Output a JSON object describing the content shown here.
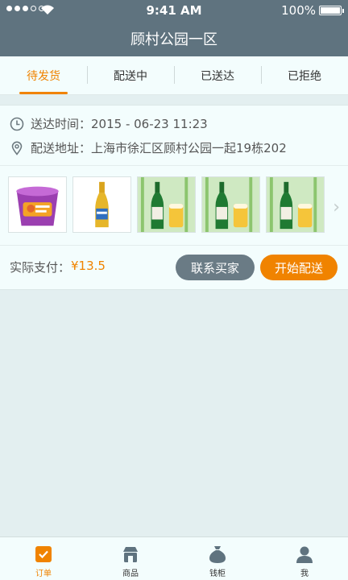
{
  "status": {
    "time": "9:41 AM",
    "battery": "100%"
  },
  "nav": {
    "title": "顾村公园一区"
  },
  "tabs": [
    {
      "label": "待发货",
      "active": true
    },
    {
      "label": "配送中",
      "active": false
    },
    {
      "label": "已送达",
      "active": false
    },
    {
      "label": "已拒绝",
      "active": false
    }
  ],
  "order": {
    "time_label": "送达时间：",
    "time_value": "2015 - 06-23   11:23",
    "address_label": "配送地址：",
    "address_value": "上海市徐汇区顾村公园一起19栋202",
    "products": [
      "instant-noodle-cup",
      "beer-bottle",
      "beer-green-bottles",
      "beer-green-bottles",
      "beer-green-bottles"
    ],
    "pay_label": "实际支付：",
    "pay_amount": "¥13.5",
    "contact_button": "联系买家",
    "start_button": "开始配送"
  },
  "tabbar": [
    {
      "label": "订单",
      "icon": "order-icon",
      "active": true
    },
    {
      "label": "商品",
      "icon": "goods-icon",
      "active": false
    },
    {
      "label": "钱柜",
      "icon": "wallet-bag-icon",
      "active": false
    },
    {
      "label": "我",
      "icon": "user-icon",
      "active": false
    }
  ],
  "colors": {
    "accent": "#f08300",
    "header": "#5f737f",
    "background": "#e3eff0"
  }
}
